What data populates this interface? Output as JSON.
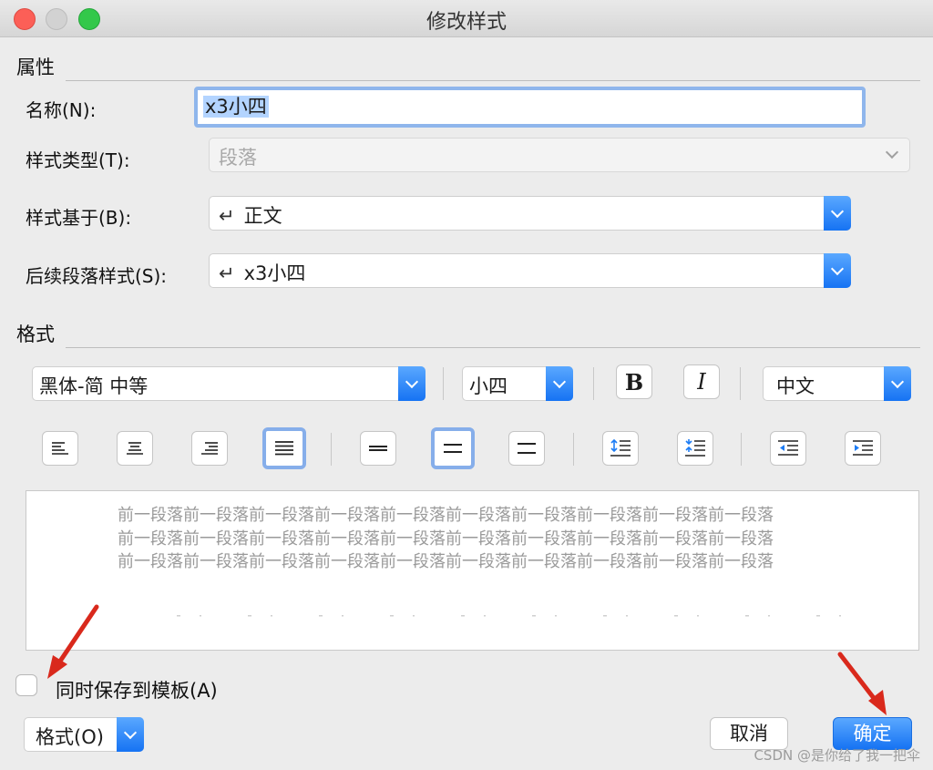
{
  "window": {
    "title": "修改样式"
  },
  "properties": {
    "heading": "属性",
    "name_label": "名称(N):",
    "name_value": "x3小四",
    "style_type_label": "样式类型(T):",
    "style_type_value": "段落",
    "based_on_label": "样式基于(B):",
    "based_on_value": "正文",
    "next_style_label": "后续段落样式(S):",
    "next_style_value": "x3小四",
    "return_glyph": "↵"
  },
  "format": {
    "heading": "格式",
    "font_name": "黑体-简 中等",
    "font_size": "小四",
    "bold_glyph": "B",
    "italic_glyph": "I",
    "script": "中文"
  },
  "preview": {
    "lines": [
      "前一段落前一段落前一段落前一段落前一段落前一段落前一段落前一段落前一段落前一段落",
      "前一段落前一段落前一段落前一段落前一段落前一段落前一段落前一段落前一段落前一段落",
      "前一段落前一段落前一段落前一段落前一段落前一段落前一段落前一段落前一段落前一段落"
    ]
  },
  "footer": {
    "save_template_label": "同时保存到模板(A)",
    "format_menu": "格式(O)",
    "cancel": "取消",
    "ok": "确定"
  },
  "watermark": "CSDN @是你给了我一把伞",
  "icons": [
    "align-left-icon",
    "align-center-icon",
    "align-right-icon",
    "align-justify-icon",
    "single-spacing-icon",
    "one-half-spacing-icon",
    "double-spacing-icon",
    "increase-paragraph-spacing-icon",
    "decrease-paragraph-spacing-icon",
    "decrease-indent-icon",
    "increase-indent-icon"
  ],
  "colors": {
    "accent": "#1c7cf5",
    "focus_ring": "#8fb6ec",
    "annotation_arrow": "#d9291c"
  }
}
